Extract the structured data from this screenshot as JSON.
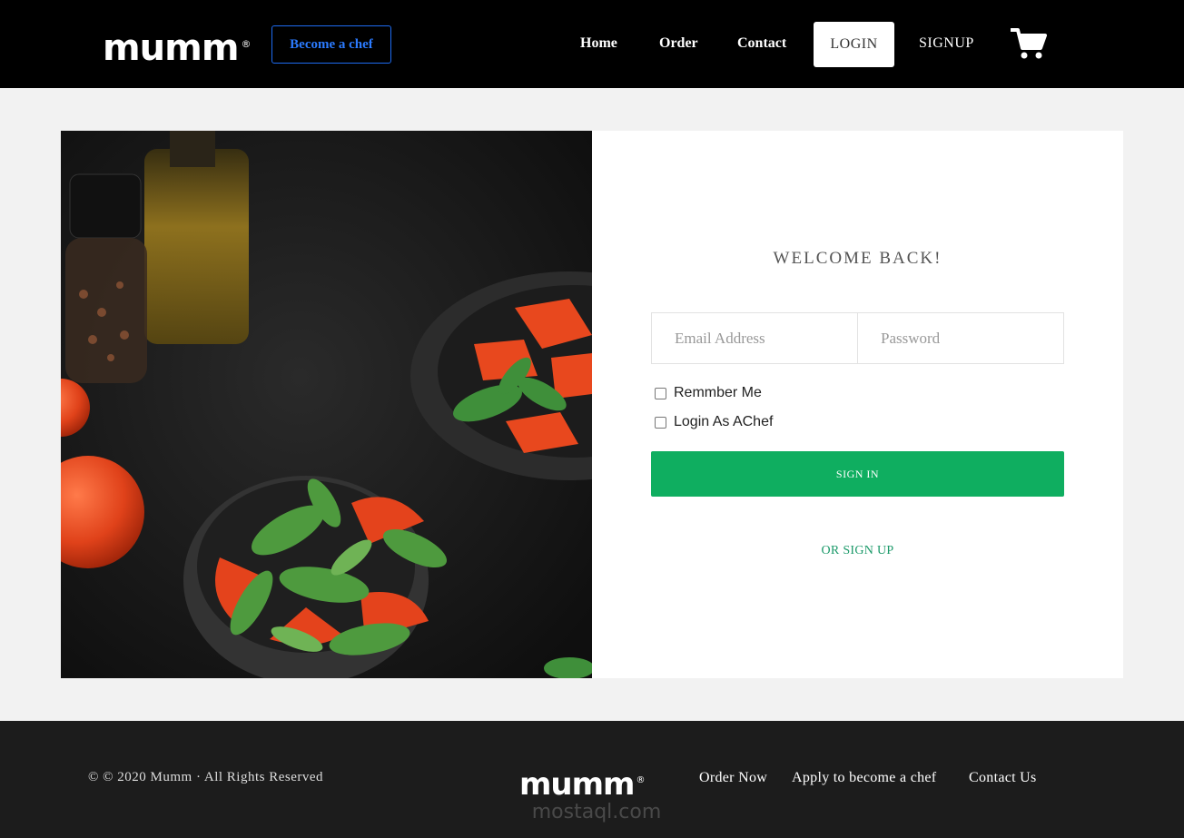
{
  "header": {
    "logo": "mumm",
    "logo_mark": "®",
    "become_chef": "Become a chef",
    "nav": {
      "home": "Home",
      "order": "Order",
      "contact": "Contact",
      "login": "LOGIN",
      "signup": "SIGNUP"
    },
    "cart_icon": "shopping-cart-icon"
  },
  "login": {
    "title": "WELCOME BACK!",
    "email_placeholder": "Email Address",
    "password_placeholder": "Password",
    "remember_label": "Remmber Me",
    "chef_label": "Login As AChef",
    "signin_button": "SIGN IN",
    "signup_link": "OR SIGN UP"
  },
  "footer": {
    "copyright": "© © 2020 Mumm · All Rights Reserved",
    "logo": "mumm",
    "logo_mark": "®",
    "links": {
      "order_now": "Order Now",
      "apply_chef": "Apply to become a chef",
      "contact_us": "Contact Us"
    }
  },
  "colors": {
    "header_bg": "#000000",
    "accent_blue": "#2b7bff",
    "signin_green": "#0fae60",
    "signup_link_green": "#1c9a6a",
    "footer_bg": "#1c1c1c"
  }
}
